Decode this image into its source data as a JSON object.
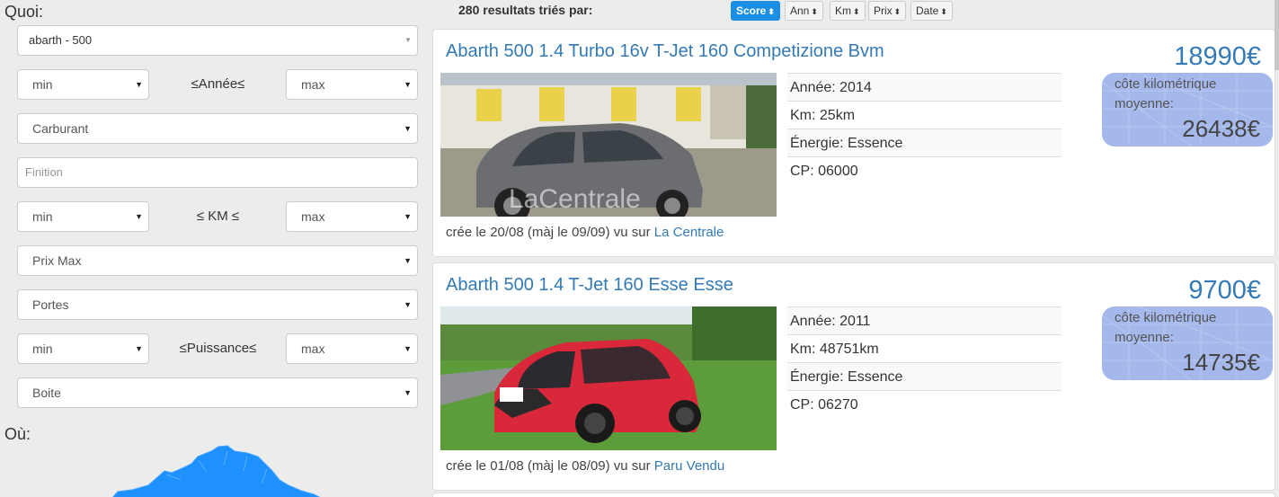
{
  "filters": {
    "quoi_label": "Quoi:",
    "model_value": "abarth - 500",
    "annee": {
      "min": "min",
      "label": "≤Année≤",
      "max": "max"
    },
    "carburant": "Carburant",
    "finition_placeholder": "Finition",
    "km": {
      "min": "min",
      "label": "≤ KM ≤",
      "max": "max"
    },
    "prix_max": "Prix Max",
    "portes": "Portes",
    "puissance": {
      "min": "min",
      "label": "≤Puissance≤",
      "max": "max"
    },
    "boite": "Boite",
    "ou_label": "Où:"
  },
  "sort": {
    "count_text": "280 resultats triés par:",
    "buttons": [
      {
        "label": "Score",
        "active": true
      },
      {
        "label": "Ann",
        "active": false
      },
      {
        "label": "Km",
        "active": false
      },
      {
        "label": "Prix",
        "active": false
      },
      {
        "label": "Date",
        "active": false
      }
    ]
  },
  "results": [
    {
      "title": "Abarth 500 1.4 Turbo 16v T-Jet 160 Competizione Bvm",
      "price": "18990€",
      "specs": [
        "Année: 2014",
        "Km: 25km",
        "Énergie: Essence",
        "CP: 06000"
      ],
      "cote_label": "côte kilométrique moyenne:",
      "cote_value": "26438€",
      "meta_prefix": "crée le 20/08 (màj le 09/09) vu sur",
      "source": "La Centrale",
      "car_color": "#6b6d70",
      "watermark": "LaCentrale"
    },
    {
      "title": "Abarth 500 1.4 T-Jet 160 Esse Esse",
      "price": "9700€",
      "specs": [
        "Année: 2011",
        "Km: 48751km",
        "Énergie: Essence",
        "CP: 06270"
      ],
      "cote_label": "côte kilométrique moyenne:",
      "cote_value": "14735€",
      "meta_prefix": "crée le 01/08 (màj le 08/09) vu sur",
      "source": "Paru Vendu",
      "car_color": "#d9283a"
    }
  ],
  "colors": {
    "accent": "#337ab7",
    "sort_active": "#1a8fe3",
    "cote_bg": "#a4b8ec",
    "map": "#1e90ff"
  }
}
